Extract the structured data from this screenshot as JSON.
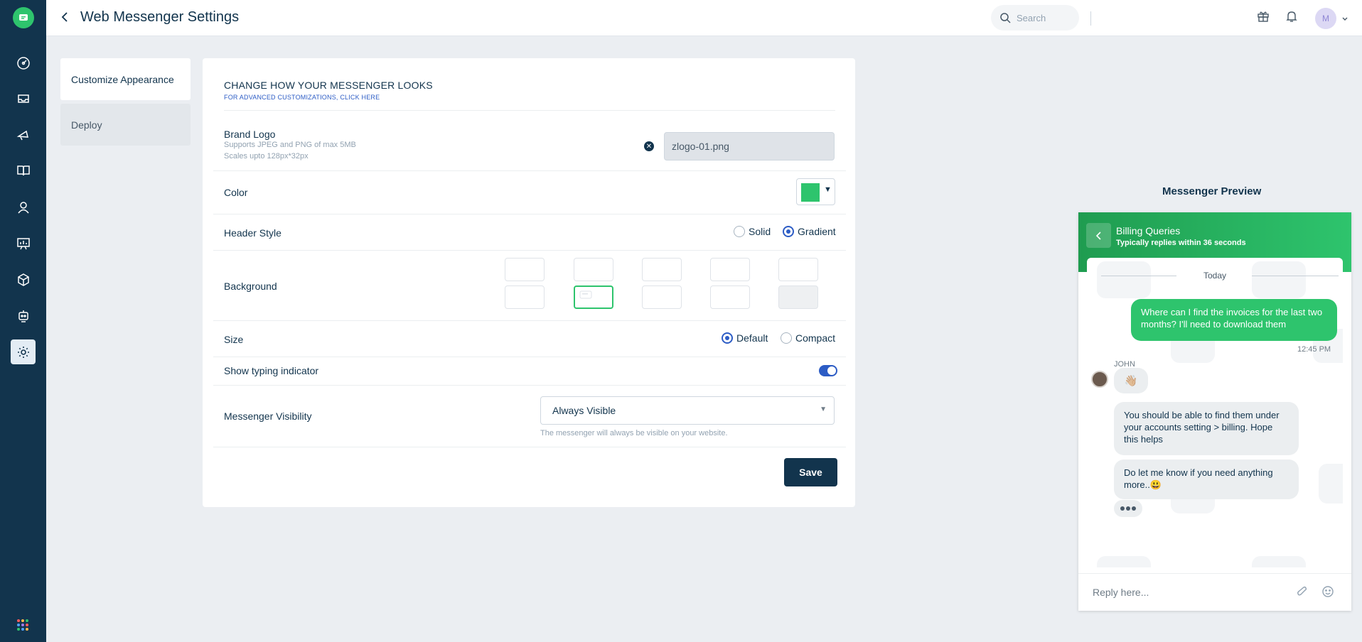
{
  "header": {
    "title": "Web Messenger Settings",
    "search_placeholder": "Search",
    "avatar_initial": "M"
  },
  "subnav": {
    "items": [
      {
        "label": "Customize Appearance",
        "active": true
      },
      {
        "label": "Deploy",
        "active": false
      }
    ]
  },
  "panel": {
    "title": "CHANGE HOW YOUR MESSENGER LOOKS",
    "link": "FOR ADVANCED CUSTOMIZATIONS, CLICK HERE",
    "brand_logo": {
      "label": "Brand Logo",
      "hint1": "Supports JPEG and PNG of max 5MB",
      "hint2": "Scales upto 128px*32px",
      "file": "zlogo-01.png"
    },
    "color": {
      "label": "Color",
      "value": "#2ec46d"
    },
    "header_style": {
      "label": "Header Style",
      "options": [
        "Solid",
        "Gradient"
      ],
      "selected": "Gradient"
    },
    "background": {
      "label": "Background",
      "selected_index": 6
    },
    "size": {
      "label": "Size",
      "options": [
        "Default",
        "Compact"
      ],
      "selected": "Default"
    },
    "typing": {
      "label": "Show typing indicator",
      "enabled": true
    },
    "visibility": {
      "label": "Messenger Visibility",
      "value": "Always Visible",
      "help": "The messenger will always be visible on your website."
    },
    "save_label": "Save"
  },
  "preview": {
    "title": "Messenger Preview",
    "header_name": "Billing Queries",
    "header_sub": "Typically replies within 36 seconds",
    "today": "Today",
    "outgoing": "Where can I find the invoices for the last two months? I'll need to download them",
    "outgoing_time": "12:45 PM",
    "agent": "JOHN",
    "wave": "👋🏼",
    "reply1": "You should be able to find them under your accounts setting > billing. Hope this helps",
    "reply2": "Do let me know if you need anything more..😃",
    "reply_placeholder": "Reply here..."
  },
  "colors": {
    "nav": "#12344d",
    "accent": "#2ec46d",
    "primary": "#2c5cc5"
  }
}
